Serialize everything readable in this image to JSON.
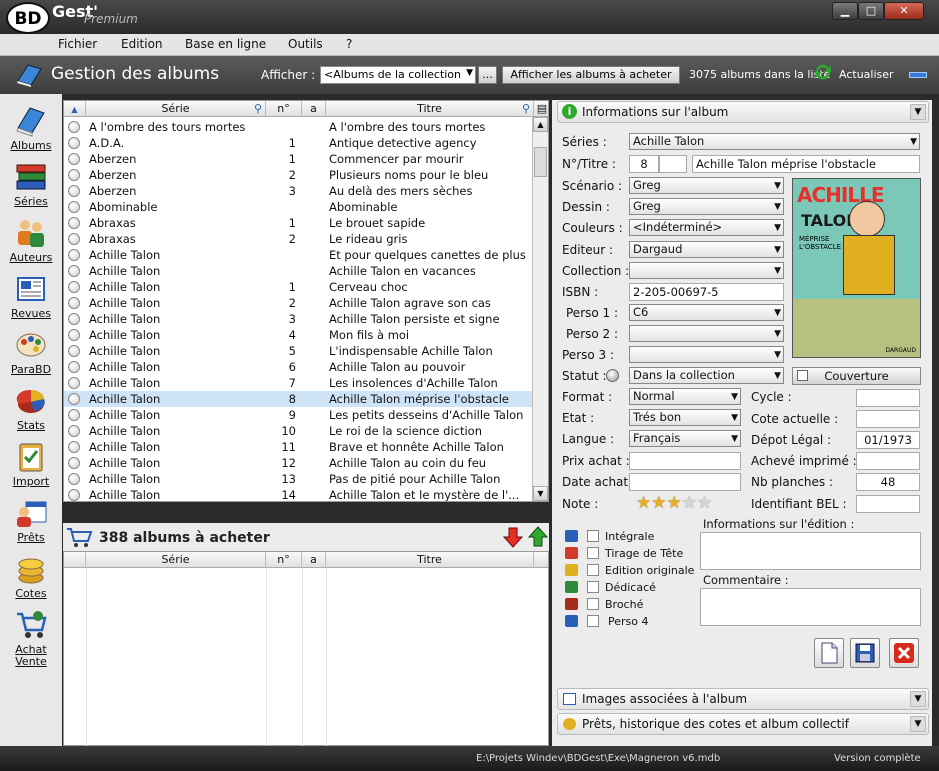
{
  "titlebar": {
    "app_name": "Gest'",
    "logo": "BD",
    "edition": "Premium",
    "buttons": [
      "minimize-icon",
      "maximize-icon",
      "close-icon"
    ]
  },
  "menu": [
    "Fichier",
    "Edition",
    "Base en ligne",
    "Outils",
    "?"
  ],
  "header": {
    "title": "Gestion des albums",
    "afficher_label": "Afficher :",
    "filter_value": "<Albums de la collection",
    "dots_label": "...",
    "buy_button": "Afficher les albums à acheter",
    "album_count": "3075 albums dans la liste",
    "refresh_label": "Actualiser"
  },
  "sidebar": [
    {
      "label": "Albums",
      "icon": "book-icon"
    },
    {
      "label": "Séries",
      "icon": "books-stack-icon"
    },
    {
      "label": "Auteurs",
      "icon": "people-icon"
    },
    {
      "label": "Revues",
      "icon": "newspaper-icon"
    },
    {
      "label": "ParaBD",
      "icon": "palette-icon"
    },
    {
      "label": "Stats",
      "icon": "pie-chart-icon"
    },
    {
      "label": "Import",
      "icon": "clipboard-icon"
    },
    {
      "label": "Prêts",
      "icon": "calendar-user-icon"
    },
    {
      "label": "Cotes",
      "icon": "coins-icon"
    },
    {
      "label": "Achat Vente",
      "icon": "cart-icon"
    }
  ],
  "grid": {
    "columns": {
      "serie": "Série",
      "num": "n°",
      "a": "a",
      "titre": "Titre"
    },
    "rows": [
      {
        "serie": "A l'ombre des tours mortes",
        "num": "",
        "titre": "A l'ombre des tours mortes"
      },
      {
        "serie": "A.D.A.",
        "num": "1",
        "titre": "Antique detective agency"
      },
      {
        "serie": "Aberzen",
        "num": "1",
        "titre": "Commencer par mourir"
      },
      {
        "serie": "Aberzen",
        "num": "2",
        "titre": "Plusieurs noms pour le bleu"
      },
      {
        "serie": "Aberzen",
        "num": "3",
        "titre": "Au delà des mers sèches"
      },
      {
        "serie": "Abominable",
        "num": "",
        "titre": "Abominable"
      },
      {
        "serie": "Abraxas",
        "num": "1",
        "titre": "Le brouet sapide"
      },
      {
        "serie": "Abraxas",
        "num": "2",
        "titre": "Le rideau gris"
      },
      {
        "serie": "Achille Talon",
        "num": "",
        "titre": "Et pour quelques canettes de plus"
      },
      {
        "serie": "Achille Talon",
        "num": "",
        "titre": "Achille Talon en vacances"
      },
      {
        "serie": "Achille Talon",
        "num": "1",
        "titre": "Cerveau choc"
      },
      {
        "serie": "Achille Talon",
        "num": "2",
        "titre": "Achille Talon agrave son cas"
      },
      {
        "serie": "Achille Talon",
        "num": "3",
        "titre": "Achille Talon persiste et signe"
      },
      {
        "serie": "Achille Talon",
        "num": "4",
        "titre": "Mon fils à moi"
      },
      {
        "serie": "Achille Talon",
        "num": "5",
        "titre": "L'indispensable Achille Talon"
      },
      {
        "serie": "Achille Talon",
        "num": "6",
        "titre": "Achille Talon au pouvoir"
      },
      {
        "serie": "Achille Talon",
        "num": "7",
        "titre": "Les insolences d'Achille Talon"
      },
      {
        "serie": "Achille Talon",
        "num": "8",
        "titre": "Achille Talon méprise l'obstacle",
        "selected": true
      },
      {
        "serie": "Achille Talon",
        "num": "9",
        "titre": "Les petits desseins d'Achille Talon"
      },
      {
        "serie": "Achille Talon",
        "num": "10",
        "titre": "Le roi de la science diction"
      },
      {
        "serie": "Achille Talon",
        "num": "11",
        "titre": "Brave et honnête Achille Talon"
      },
      {
        "serie": "Achille Talon",
        "num": "12",
        "titre": "Achille Talon au coin du feu"
      },
      {
        "serie": "Achille Talon",
        "num": "13",
        "titre": "Pas de pitié pour Achille Talon"
      },
      {
        "serie": "Achille Talon",
        "num": "14",
        "titre": "Achille Talon et le mystère de l'..."
      }
    ]
  },
  "buy": {
    "count_label": "388 albums à acheter",
    "columns": {
      "serie": "Série",
      "num": "n°",
      "a": "a",
      "titre": "Titre"
    }
  },
  "info": {
    "section_title": "Informations sur l'album",
    "series_label": "Séries :",
    "series_value": "Achille Talon",
    "numtitre_label": "N°/Titre :",
    "num_value": "8",
    "num_suffix": "",
    "titre_value": "Achille Talon méprise l'obstacle",
    "scenario_label": "Scénario :",
    "scenario_value": "Greg",
    "dessin_label": "Dessin :",
    "dessin_value": "Greg",
    "couleurs_label": "Couleurs :",
    "couleurs_value": "<Indéterminé>",
    "editeur_label": "Editeur :",
    "editeur_value": "Dargaud",
    "collection_label": "Collection :",
    "collection_value": "",
    "isbn_label": "ISBN :",
    "isbn_value": "2-205-00697-5",
    "perso1_label": "Perso 1 :",
    "perso1_value": "C6",
    "perso2_label": "Perso 2 :",
    "perso2_value": "",
    "perso3_label": "Perso 3 :",
    "perso3_value": "",
    "statut_label": "Statut :",
    "statut_value": "Dans la collection",
    "couverture_button": "Couverture",
    "format_label": "Format :",
    "format_value": "Normal",
    "cycle_label": "Cycle :",
    "cycle_value": "",
    "etat_label": "Etat :",
    "etat_value": "Trés bon",
    "cote_label": "Cote actuelle :",
    "cote_value": "",
    "langue_label": "Langue :",
    "langue_value": "Français",
    "depot_label": "Dépot Légal :",
    "depot_value": "01/1973",
    "prix_label": "Prix achat :",
    "prix_value": "",
    "acheve_label": "Achevé imprimé :",
    "acheve_value": "",
    "date_label": "Date achat :",
    "date_value": "",
    "planches_label": "Nb planches :",
    "planches_value": "48",
    "note_label": "Note :",
    "note_stars": 3,
    "note_max": 5,
    "bel_label": "Identifiant BEL :",
    "bel_value": "",
    "checkboxes": [
      "Intégrale",
      "Tirage de Tête",
      "Edition originale",
      "Dédicacé",
      "Broché",
      "Perso 4"
    ],
    "edition_label": "Informations sur l'édition :",
    "comment_label": "Commentaire :",
    "cover": {
      "text1": "ACHILLE",
      "text2": "TALON",
      "text3": "MÉPRISE L'OBSTACLE",
      "publisher": "DARGAUD"
    },
    "images_section": "Images associées à l'album",
    "prets_section": "Prêts, historique des cotes et album collectif"
  },
  "status": {
    "path": "E:\\Projets Windev\\BDGest\\Exe\\Magneron v6.mdb",
    "version": "Version complète"
  }
}
